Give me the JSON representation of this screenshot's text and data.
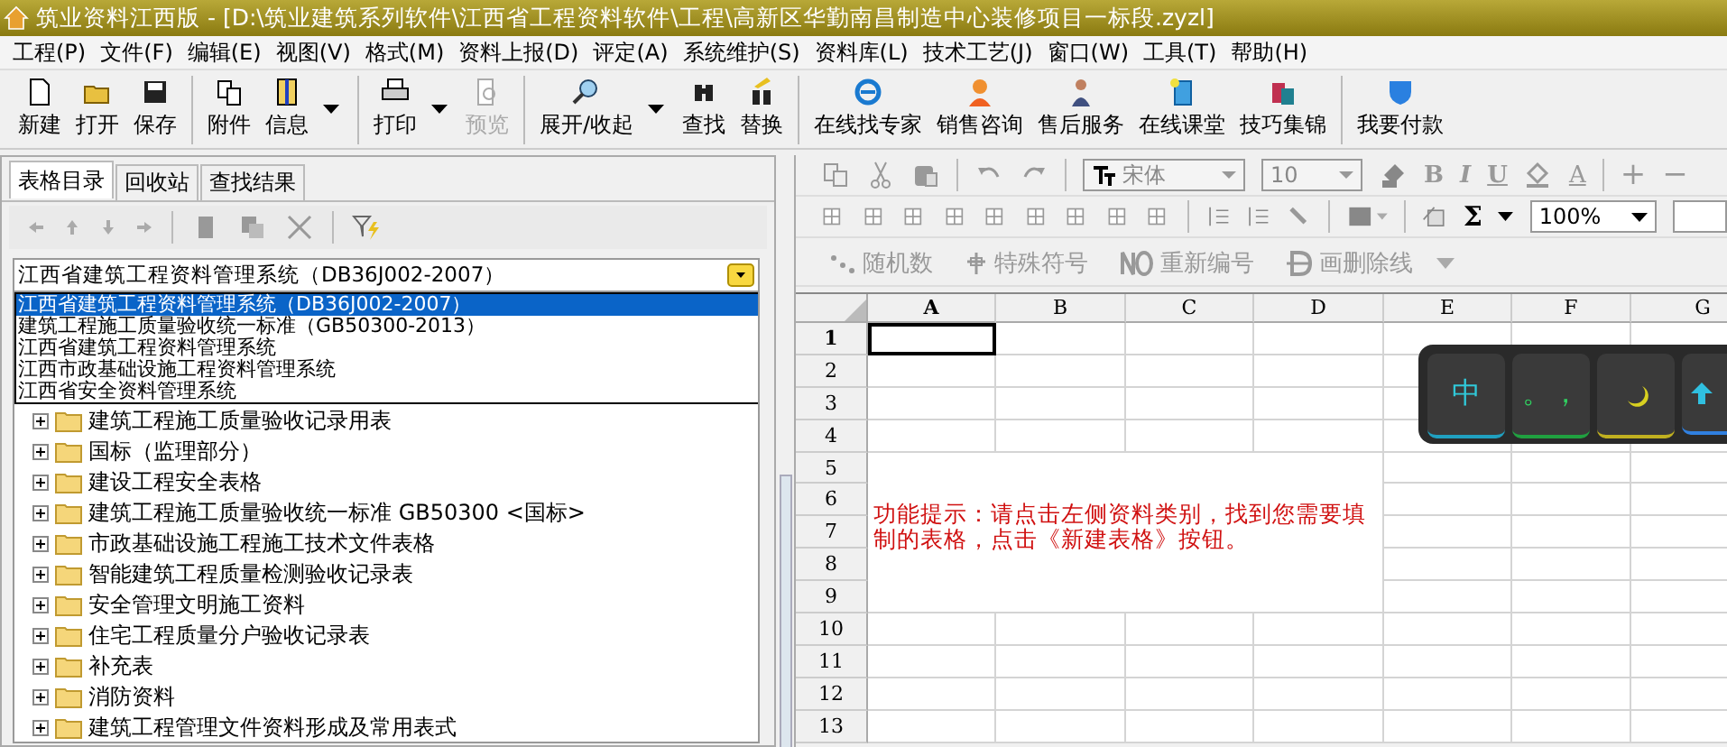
{
  "window": {
    "title": "筑业资料江西版 - [D:\\筑业建筑系列软件\\江西省工程资料软件\\工程\\高新区华勤南昌制造中心装修项目一标段.zyzl]"
  },
  "menu": [
    "工程(P)",
    "文件(F)",
    "编辑(E)",
    "视图(V)",
    "格式(M)",
    "资料上报(D)",
    "评定(A)",
    "系统维护(S)",
    "资料库(L)",
    "技术工艺(J)",
    "窗口(W)",
    "工具(T)",
    "帮助(H)"
  ],
  "toolbar": [
    {
      "label": "新建",
      "disabled": false,
      "dropdown": false,
      "separator_before": false
    },
    {
      "label": "打开",
      "disabled": false,
      "dropdown": false,
      "separator_before": false
    },
    {
      "label": "保存",
      "disabled": false,
      "dropdown": false,
      "separator_before": false
    },
    {
      "label": "附件",
      "disabled": false,
      "dropdown": false,
      "separator_before": true
    },
    {
      "label": "信息",
      "disabled": false,
      "dropdown": true,
      "separator_before": false
    },
    {
      "label": "打印",
      "disabled": false,
      "dropdown": true,
      "separator_before": true
    },
    {
      "label": "预览",
      "disabled": true,
      "dropdown": false,
      "separator_before": false
    },
    {
      "label": "展开/收起",
      "disabled": false,
      "dropdown": true,
      "separator_before": true
    },
    {
      "label": "查找",
      "disabled": false,
      "dropdown": false,
      "separator_before": false
    },
    {
      "label": "替换",
      "disabled": false,
      "dropdown": false,
      "separator_before": false
    },
    {
      "label": "在线找专家",
      "disabled": false,
      "dropdown": false,
      "separator_before": true
    },
    {
      "label": "销售咨询",
      "disabled": false,
      "dropdown": false,
      "separator_before": false
    },
    {
      "label": "售后服务",
      "disabled": false,
      "dropdown": false,
      "separator_before": false
    },
    {
      "label": "在线课堂",
      "disabled": false,
      "dropdown": false,
      "separator_before": false
    },
    {
      "label": "技巧集锦",
      "disabled": false,
      "dropdown": false,
      "separator_before": false
    },
    {
      "label": "我要付款",
      "disabled": false,
      "dropdown": false,
      "separator_before": true
    }
  ],
  "left_panel": {
    "tabs": [
      {
        "label": "表格目录",
        "selected": true
      },
      {
        "label": "回收站",
        "selected": false
      },
      {
        "label": "查找结果",
        "selected": false
      }
    ],
    "category": {
      "value": "江西省建筑工程资料管理系统（DB36J002-2007）"
    },
    "category_options": [
      {
        "label": "江西省建筑工程资料管理系统（DB36J002-2007）",
        "selected": true
      },
      {
        "label": "建筑工程施工质量验收统一标准（GB50300-2013）",
        "selected": false
      },
      {
        "label": "江西省建筑工程资料管理系统",
        "selected": false
      },
      {
        "label": "江西市政基础设施工程资料管理系统",
        "selected": false
      },
      {
        "label": "江西省安全资料管理系统",
        "selected": false
      }
    ],
    "tree": [
      {
        "label": "建筑工程施工质量验收记录用表",
        "expanded": false
      },
      {
        "label": "国标（监理部分）",
        "expanded": false
      },
      {
        "label": "建设工程安全表格",
        "expanded": false
      },
      {
        "label": "建筑工程施工质量验收统一标准 GB50300 <国标>",
        "expanded": false
      },
      {
        "label": "市政基础设施工程施工技术文件表格",
        "expanded": false
      },
      {
        "label": "智能建筑工程质量检测验收记录表",
        "expanded": false
      },
      {
        "label": "安全管理文明施工资料",
        "expanded": false
      },
      {
        "label": "住宅工程质量分户验收记录表",
        "expanded": false
      },
      {
        "label": "补充表",
        "expanded": false
      },
      {
        "label": "消防资料",
        "expanded": false
      },
      {
        "label": "建筑工程管理文件资料形成及常用表式",
        "expanded": false
      }
    ]
  },
  "format_toolbar": {
    "font": "宋体",
    "size": "10",
    "style_buttons": [
      "B",
      "I",
      "U"
    ],
    "color_button": "A",
    "zoom_buttons": [
      "+",
      "−"
    ],
    "sum_button": "Σ",
    "zoom": "100%"
  },
  "text_tools": [
    {
      "label": "随机数",
      "disabled": true
    },
    {
      "label": "特殊符号",
      "disabled": true
    },
    {
      "label": "重新编号",
      "disabled": true
    },
    {
      "label": "画删除线",
      "disabled": true
    }
  ],
  "spreadsheet": {
    "columns": [
      {
        "label": "A",
        "selected": true
      },
      {
        "label": "B",
        "selected": false
      },
      {
        "label": "C",
        "selected": false
      },
      {
        "label": "D",
        "selected": false
      },
      {
        "label": "E",
        "selected": false
      },
      {
        "label": "F",
        "selected": false
      },
      {
        "label": "G",
        "selected": false
      }
    ],
    "rows": [
      {
        "label": "1",
        "selected": true
      },
      {
        "label": "2",
        "selected": false
      },
      {
        "label": "3",
        "selected": false
      },
      {
        "label": "4",
        "selected": false
      },
      {
        "label": "5",
        "selected": false
      },
      {
        "label": "6",
        "selected": false
      },
      {
        "label": "7",
        "selected": false
      },
      {
        "label": "8",
        "selected": false
      },
      {
        "label": "9",
        "selected": false
      },
      {
        "label": "10",
        "selected": false
      },
      {
        "label": "11",
        "selected": false
      },
      {
        "label": "12",
        "selected": false
      },
      {
        "label": "13",
        "selected": false
      }
    ],
    "hint": "功能提示：请点击左侧资料类别，找到您需要填制的表格，点击《新建表格》按钮。"
  },
  "ime_bar": {
    "keys": [
      "中",
      "。，"
    ]
  }
}
